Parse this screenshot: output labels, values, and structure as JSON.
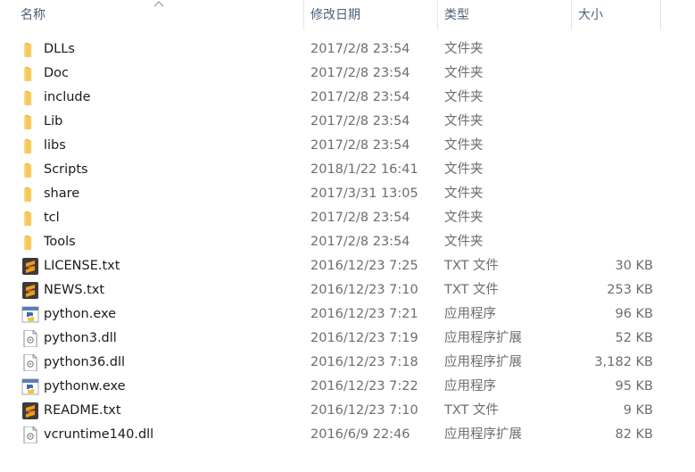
{
  "columns": {
    "name": "名称",
    "date": "修改日期",
    "type": "类型",
    "size": "大小"
  },
  "files": [
    {
      "name": "DLLs",
      "date": "2017/2/8 23:54",
      "type": "文件夹",
      "size": "",
      "icon": "folder-icon"
    },
    {
      "name": "Doc",
      "date": "2017/2/8 23:54",
      "type": "文件夹",
      "size": "",
      "icon": "folder-icon"
    },
    {
      "name": "include",
      "date": "2017/2/8 23:54",
      "type": "文件夹",
      "size": "",
      "icon": "folder-icon"
    },
    {
      "name": "Lib",
      "date": "2017/2/8 23:54",
      "type": "文件夹",
      "size": "",
      "icon": "folder-icon"
    },
    {
      "name": "libs",
      "date": "2017/2/8 23:54",
      "type": "文件夹",
      "size": "",
      "icon": "folder-icon"
    },
    {
      "name": "Scripts",
      "date": "2018/1/22 16:41",
      "type": "文件夹",
      "size": "",
      "icon": "folder-icon"
    },
    {
      "name": "share",
      "date": "2017/3/31 13:05",
      "type": "文件夹",
      "size": "",
      "icon": "folder-icon"
    },
    {
      "name": "tcl",
      "date": "2017/2/8 23:54",
      "type": "文件夹",
      "size": "",
      "icon": "folder-icon"
    },
    {
      "name": "Tools",
      "date": "2017/2/8 23:54",
      "type": "文件夹",
      "size": "",
      "icon": "folder-icon"
    },
    {
      "name": "LICENSE.txt",
      "date": "2016/12/23 7:25",
      "type": "TXT 文件",
      "size": "30 KB",
      "icon": "sublime-text-icon"
    },
    {
      "name": "NEWS.txt",
      "date": "2016/12/23 7:10",
      "type": "TXT 文件",
      "size": "253 KB",
      "icon": "sublime-text-icon"
    },
    {
      "name": "python.exe",
      "date": "2016/12/23 7:21",
      "type": "应用程序",
      "size": "96 KB",
      "icon": "python-exe-icon"
    },
    {
      "name": "python3.dll",
      "date": "2016/12/23 7:19",
      "type": "应用程序扩展",
      "size": "52 KB",
      "icon": "dll-file-icon"
    },
    {
      "name": "python36.dll",
      "date": "2016/12/23 7:18",
      "type": "应用程序扩展",
      "size": "3,182 KB",
      "icon": "dll-file-icon"
    },
    {
      "name": "pythonw.exe",
      "date": "2016/12/23 7:22",
      "type": "应用程序",
      "size": "95 KB",
      "icon": "python-exe-icon"
    },
    {
      "name": "README.txt",
      "date": "2016/12/23 7:10",
      "type": "TXT 文件",
      "size": "9 KB",
      "icon": "sublime-text-icon"
    },
    {
      "name": "vcruntime140.dll",
      "date": "2016/6/9 22:46",
      "type": "应用程序扩展",
      "size": "82 KB",
      "icon": "dll-file-icon"
    }
  ],
  "colors": {
    "header_text": "#4c607a",
    "name_text": "#1a1a1a",
    "meta_text": "#6d6d6d",
    "folder": "#f7c85a",
    "sublime": "#f39c12"
  }
}
